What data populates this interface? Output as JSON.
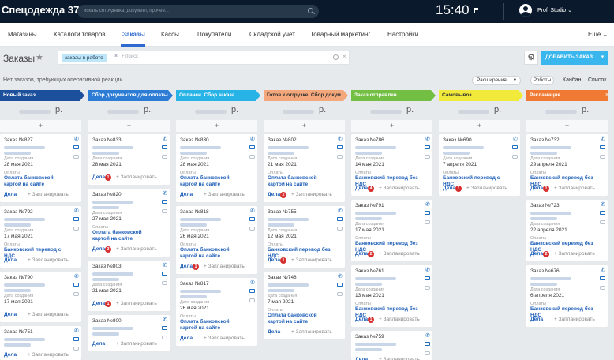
{
  "app": {
    "title": "Спецодежда 37",
    "search_placeholder": "искать сотрудника, документ, прочее...",
    "time": "15:40",
    "user": "Profi Studio"
  },
  "nav": {
    "items": [
      "Магазины",
      "Каталоги товаров",
      "Заказы",
      "Кассы",
      "Покупатели",
      "Складской учет",
      "Товарный маркетинг",
      "Настройки"
    ],
    "active": "Заказы",
    "more": "Еще"
  },
  "toolbar": {
    "title": "Заказы",
    "filter_chip": "заказы в работе",
    "filter_placeholder": "+ поиск",
    "add_button": "ДОБАВИТЬ ЗАКАЗ"
  },
  "subbar": {
    "message": "Нет заказов, требующих оперативной реакции",
    "extensions": "Расширения",
    "robots": "Роботы",
    "kanban": "Канбан",
    "list": "Список"
  },
  "labels": {
    "created": "Дата создания",
    "payments": "Оплаты",
    "deals": "Дела",
    "scheduled": "+ Запланировать",
    "currency": "р."
  },
  "colors": {
    "accent": "#39b6ee",
    "nav_active": "#2f6ad0",
    "link": "#1e5fb8",
    "badge": "#d62f2f"
  },
  "columns": [
    {
      "title": "Новый заказ",
      "color": "#1c4f9c",
      "text": "#ffffff",
      "cards": [
        {
          "number": "Заказ №827",
          "date": "28 мая 2021",
          "payment": "Оплата банковской картой на сайте",
          "badge": ""
        },
        {
          "number": "Заказ №792",
          "date": "17 мая 2021",
          "payment": "Банковский перевод с НДС",
          "badge": ""
        },
        {
          "number": "Заказ №790",
          "date": "17 мая 2021",
          "payment": "",
          "badge": ""
        },
        {
          "number": "Заказ №751",
          "date": "",
          "payment": "",
          "badge": ""
        }
      ]
    },
    {
      "title": "Сбор документов для оплаты",
      "color": "#2c7cd6",
      "text": "#ffffff",
      "cards": [
        {
          "number": "Заказ №833",
          "date": "28 мая 2021",
          "payment": "",
          "badge": "1"
        },
        {
          "number": "Заказ №820",
          "date": "27 мая 2021",
          "payment": "Оплата банковской картой на сайте",
          "badge": "3"
        },
        {
          "number": "Заказ №803",
          "date": "21 мая 2021",
          "payment": "",
          "badge": "1"
        },
        {
          "number": "Заказ №800",
          "date": "",
          "payment": "",
          "badge": ""
        }
      ]
    },
    {
      "title": "Оплачен. Сбор заказа",
      "color": "#27b3e6",
      "text": "#ffffff",
      "cards": [
        {
          "number": "Заказ №830",
          "date": "28 мая 2021",
          "payment": "Оплата банковской картой на сайте",
          "badge": ""
        },
        {
          "number": "Заказ №818",
          "date": "26 мая 2021",
          "payment": "Оплата банковской картой на сайте",
          "badge": "1"
        },
        {
          "number": "Заказ №817",
          "date": "26 мая 2021",
          "payment": "Оплата банковской картой на сайте",
          "badge": ""
        }
      ]
    },
    {
      "title": "Готов к отгрузке. Сбор докум...",
      "color": "#f4a77a",
      "text": "#333333",
      "cards": [
        {
          "number": "Заказ №802",
          "date": "21 мая 2021",
          "payment": "Оплата банковской картой на сайте",
          "badge": "2"
        },
        {
          "number": "Заказ №755",
          "date": "12 мая 2021",
          "payment": "Банковский перевод без НДС",
          "badge": "1"
        },
        {
          "number": "Заказ №748",
          "date": "7 мая 2021",
          "payment": "Оплата банковской картой на сайте",
          "badge": ""
        }
      ]
    },
    {
      "title": "Заказ отправлен",
      "color": "#72bf44",
      "text": "#ffffff",
      "cards": [
        {
          "number": "Заказ №786",
          "date": "14 мая 2021",
          "payment": "Банковский перевод без НДС",
          "badge": "4"
        },
        {
          "number": "Заказ №791",
          "date": "17 мая 2021",
          "payment": "Банковский перевод без НДС",
          "badge": "2"
        },
        {
          "number": "Заказ №761",
          "date": "13 мая 2021",
          "payment": "Банковский перевод без НДС",
          "badge": "1"
        },
        {
          "number": "Заказ №759",
          "date": "",
          "payment": "",
          "badge": ""
        }
      ]
    },
    {
      "title": "Самовывоз",
      "color": "#f2ea3b",
      "text": "#333333",
      "cards": [
        {
          "number": "Заказ №690",
          "date": "7 апреля 2021",
          "payment": "Банковский перевод с НДС",
          "badge": "1"
        }
      ]
    },
    {
      "title": "Рекламация",
      "color": "#f07a34",
      "text": "#ffffff",
      "cards": [
        {
          "number": "Заказ №732",
          "date": "29 апреля 2021",
          "payment": "Банковский перевод без НДС",
          "badge": "1"
        },
        {
          "number": "Заказ №723",
          "date": "22 апреля 2021",
          "payment": "Банковский перевод без НДС",
          "badge": "2"
        },
        {
          "number": "Заказ №676",
          "date": "6 апреля 2021",
          "payment": "Банковский перевод без НДС",
          "badge": ""
        }
      ]
    }
  ]
}
